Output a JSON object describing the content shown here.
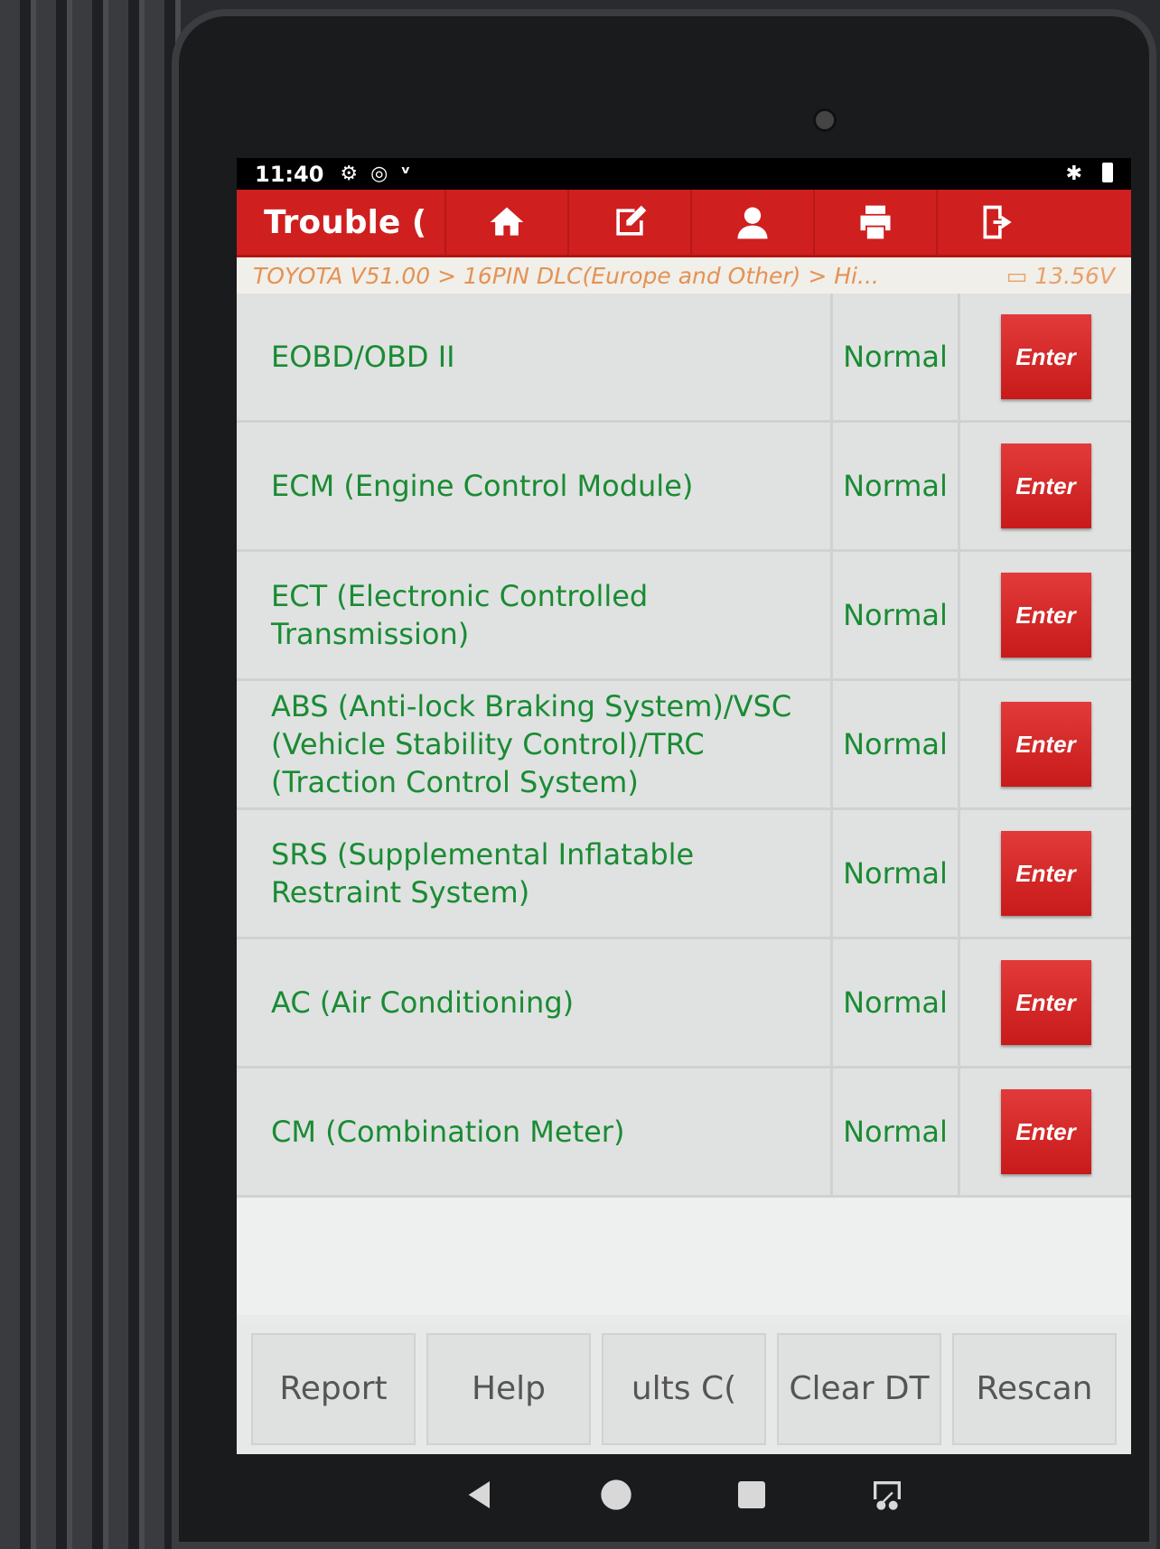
{
  "statusbar": {
    "time": "11:40"
  },
  "header": {
    "title": "Trouble ("
  },
  "breadcrumb": {
    "path": "TOYOTA V51.00 > 16PIN DLC(Europe and Other) > Hi...",
    "voltage": "13.56V"
  },
  "systems": [
    {
      "name": "EOBD/OBD II",
      "status": "Normal",
      "action": "Enter"
    },
    {
      "name": "ECM (Engine Control Module)",
      "status": "Normal",
      "action": "Enter"
    },
    {
      "name": "ECT (Electronic Controlled Transmission)",
      "status": "Normal",
      "action": "Enter"
    },
    {
      "name": "ABS (Anti-lock Braking System)/VSC (Vehicle Stability Control)/TRC (Traction Control System)",
      "status": "Normal",
      "action": "Enter"
    },
    {
      "name": "SRS (Supplemental Inflatable Restraint System)",
      "status": "Normal",
      "action": "Enter"
    },
    {
      "name": "AC (Air Conditioning)",
      "status": "Normal",
      "action": "Enter"
    },
    {
      "name": "CM (Combination Meter)",
      "status": "Normal",
      "action": "Enter"
    }
  ],
  "bottombar": {
    "report": "Report",
    "help": "Help",
    "results": "ults   C(",
    "clear": "Clear DT",
    "rescan": "Rescan"
  },
  "colors": {
    "accent": "#cf1f1f",
    "text_green": "#1a8b33",
    "breadcrumb": "#e49255"
  }
}
